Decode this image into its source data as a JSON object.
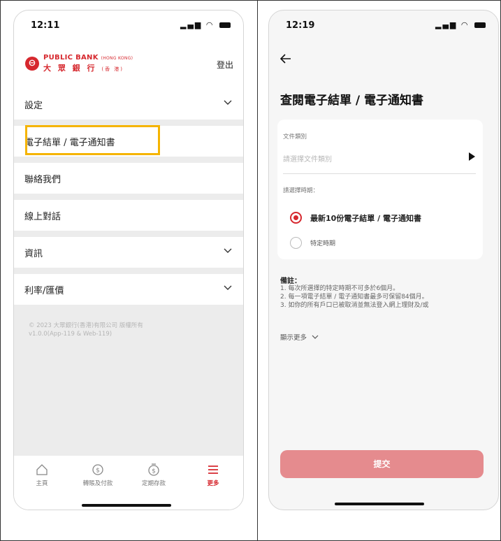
{
  "colors": {
    "brand": "#d6282e",
    "highlight": "#f5b400",
    "submit_bg": "#e58b8e"
  },
  "screen1": {
    "status_time": "12:11",
    "logo": {
      "en": "PUBLIC BANK",
      "en_sub": "(HONG KONG)",
      "zh": "大 眾 銀 行",
      "zh_sub": "(香 港)"
    },
    "logout_label": "登出",
    "menu": [
      {
        "label": "設定",
        "expandable": true
      },
      {
        "label": "電子結單 / 電子通知書",
        "expandable": false,
        "highlighted": true
      },
      {
        "label": "聯絡我們",
        "expandable": false
      },
      {
        "label": "線上對話",
        "expandable": false
      },
      {
        "label": "資訊",
        "expandable": true
      },
      {
        "label": "利率/匯價",
        "expandable": true
      }
    ],
    "copyright_line1": "© 2023 大眾銀行(香港)有限公司 版權所有",
    "copyright_line2": "v1.0.0(App-119 & Web-119)",
    "tabs": [
      {
        "label": "主頁",
        "icon": "home-icon",
        "active": false
      },
      {
        "label": "轉賬及付款",
        "icon": "transfer-payment-icon",
        "active": false
      },
      {
        "label": "定期存款",
        "icon": "time-deposit-icon",
        "active": false
      },
      {
        "label": "更多",
        "icon": "more-menu-icon",
        "active": true
      }
    ]
  },
  "screen2": {
    "status_time": "12:19",
    "title": "查閱電子結單 / 電子通知書",
    "doc_type_label": "文件類別",
    "doc_type_placeholder": "請選擇文件類別",
    "period_label": "請選擇時期：",
    "options": [
      {
        "label": "最新10份電子結單 / 電子通知書",
        "selected": true
      },
      {
        "label": "特定時期",
        "selected": false
      }
    ],
    "notes_title": "備註：",
    "notes": [
      "1. 每次所選擇的特定時期不可多於6個月。",
      "2. 每一項電子結單 / 電子通知書最多可保留84個月。",
      "3. 如你的所有戶口已被取消並無法登入網上理財及/或"
    ],
    "show_more": "顯示更多",
    "submit_label": "提交"
  }
}
